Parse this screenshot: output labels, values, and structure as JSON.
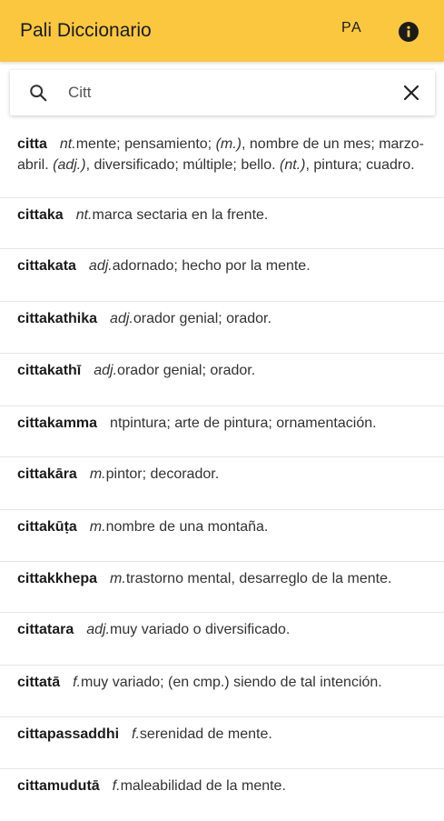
{
  "app": {
    "title": "Pali Diccionario",
    "language_label": "PA",
    "accent_color": "#fbc73f"
  },
  "search": {
    "value": "Citt",
    "placeholder": ""
  },
  "entries": [
    {
      "word": "citta",
      "segments": [
        {
          "t": "nt.",
          "i": true
        },
        {
          "t": "mente; pensamiento; "
        },
        {
          "t": "(m.)",
          "i": true
        },
        {
          "t": ", nombre de un mes; marzo-abril. "
        },
        {
          "t": "(adj.)",
          "i": true
        },
        {
          "t": ", diversificado; múltiple; bello. "
        },
        {
          "t": "(nt.)",
          "i": true
        },
        {
          "t": ", pintura; cuadro."
        }
      ]
    },
    {
      "word": "cittaka",
      "segments": [
        {
          "t": "nt.",
          "i": true
        },
        {
          "t": "marca sectaria en la frente."
        }
      ]
    },
    {
      "word": "cittakata",
      "segments": [
        {
          "t": "adj.",
          "i": true
        },
        {
          "t": "adornado; hecho por la mente."
        }
      ]
    },
    {
      "word": "cittakathika",
      "segments": [
        {
          "t": "adj.",
          "i": true
        },
        {
          "t": "orador genial; orador."
        }
      ]
    },
    {
      "word": "cittakathī",
      "segments": [
        {
          "t": "adj.",
          "i": true
        },
        {
          "t": "orador genial; orador."
        }
      ]
    },
    {
      "word": "cittakamma",
      "segments": [
        {
          "t": "ntpintura; arte de pintura; ornamentación."
        }
      ]
    },
    {
      "word": "cittakāra",
      "segments": [
        {
          "t": "m.",
          "i": true
        },
        {
          "t": "pintor; decorador."
        }
      ]
    },
    {
      "word": "cittakūṭa",
      "segments": [
        {
          "t": "m.",
          "i": true
        },
        {
          "t": "nombre de una montaña."
        }
      ]
    },
    {
      "word": "cittakkhepa",
      "segments": [
        {
          "t": "m.",
          "i": true
        },
        {
          "t": "trastorno mental, desarreglo de la mente."
        }
      ]
    },
    {
      "word": "cittatara",
      "segments": [
        {
          "t": "adj.",
          "i": true
        },
        {
          "t": "muy variado o diversificado."
        }
      ]
    },
    {
      "word": "cittatā",
      "segments": [
        {
          "t": "f.",
          "i": true
        },
        {
          "t": "muy variado; (en cmp.) siendo de tal intención."
        }
      ]
    },
    {
      "word": "cittapassaddhi",
      "segments": [
        {
          "t": "f.",
          "i": true
        },
        {
          "t": "serenidad de mente."
        }
      ]
    },
    {
      "word": "cittamudutā",
      "segments": [
        {
          "t": "f.",
          "i": true
        },
        {
          "t": "maleabilidad de la mente."
        }
      ]
    }
  ]
}
